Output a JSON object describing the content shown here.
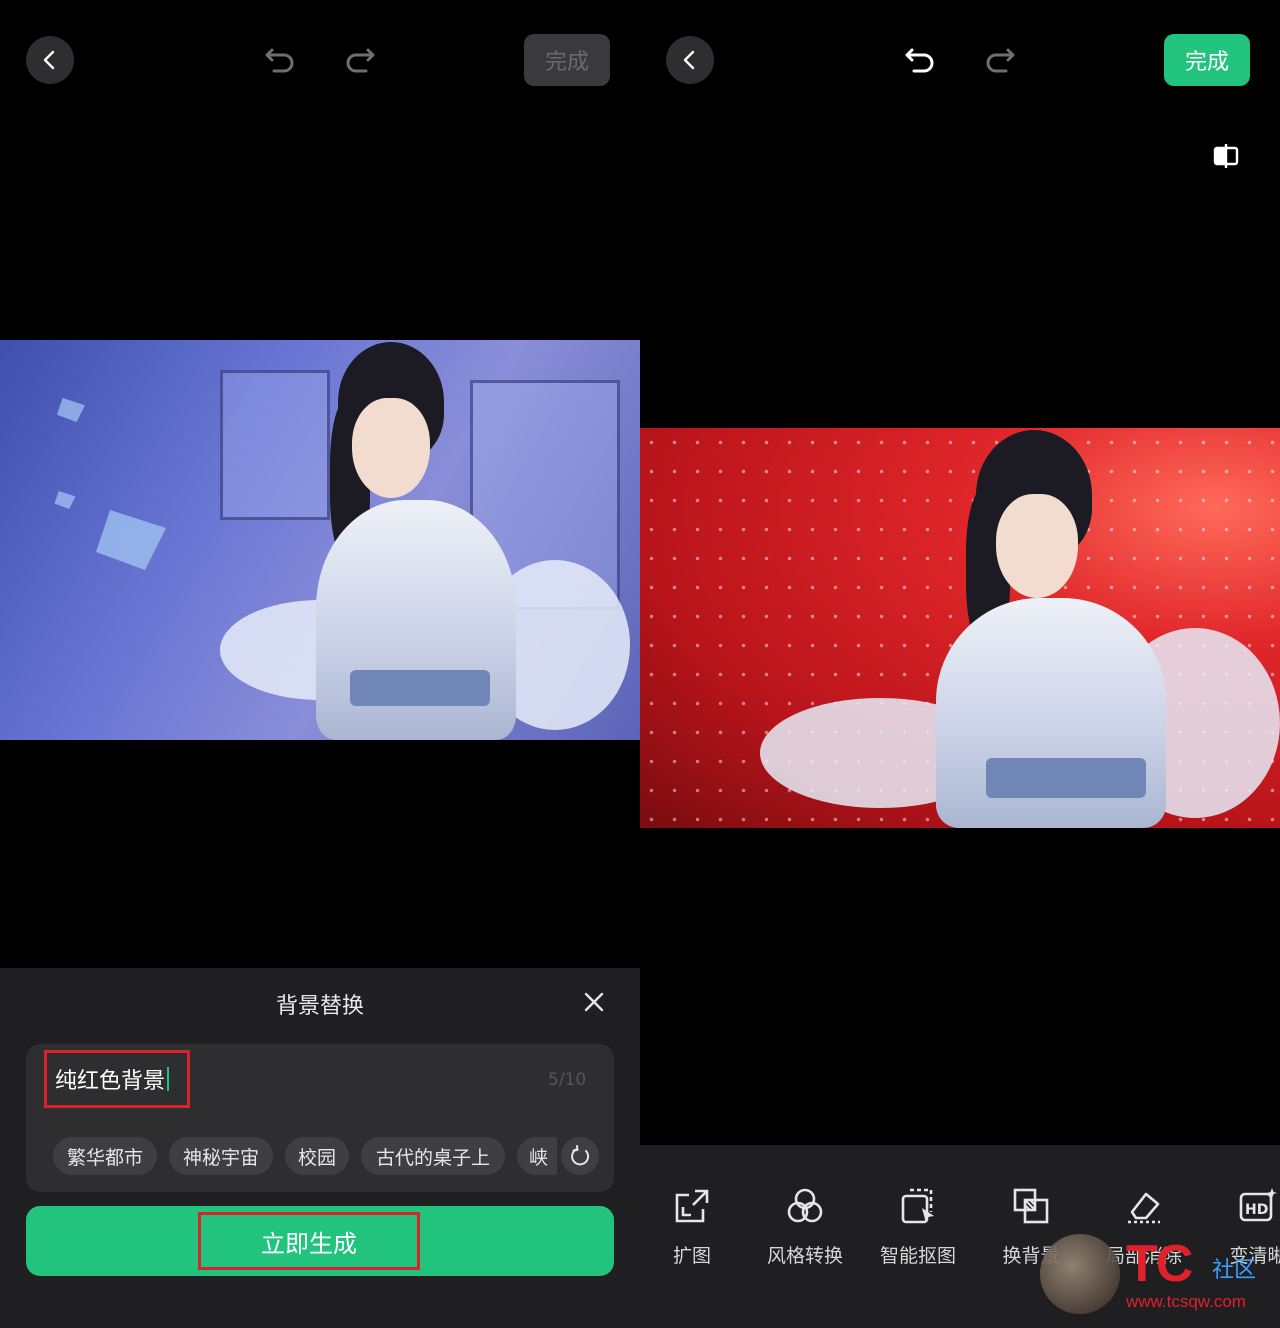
{
  "left_screen": {
    "done_label": "完成",
    "sheet": {
      "title": "背景替换",
      "prompt_value": "纯红色背景",
      "char_counter": "5/10",
      "suggestions": [
        "繁华都市",
        "神秘宇宙",
        "校园",
        "古代的桌子上",
        "峡"
      ],
      "generate_label": "立即生成"
    }
  },
  "right_screen": {
    "done_label": "完成",
    "tools": [
      {
        "label": "扩图",
        "icon": "expand-image-icon"
      },
      {
        "label": "风格转换",
        "icon": "style-transfer-icon"
      },
      {
        "label": "智能抠图",
        "icon": "smart-cutout-icon"
      },
      {
        "label": "换背景",
        "icon": "change-background-icon"
      },
      {
        "label": "局部消除",
        "icon": "eraser-icon"
      },
      {
        "label": "变清晰",
        "icon": "hd-enhance-icon"
      }
    ]
  },
  "watermark": {
    "mark": "TC",
    "cn": "社区",
    "url": "www.tcsqw.com"
  },
  "colors": {
    "accent_green": "#22c47d",
    "highlight_red": "#d9232c",
    "sheet_bg": "#1f1f21"
  }
}
